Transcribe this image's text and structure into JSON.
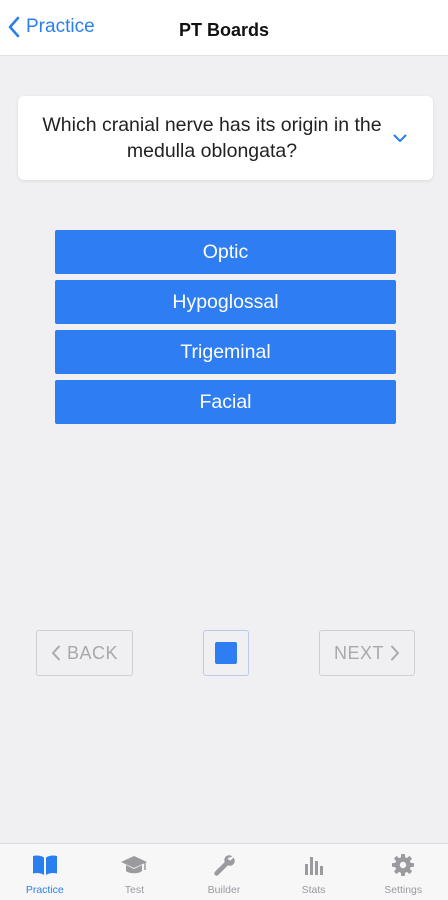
{
  "navbar": {
    "back_label": "Practice",
    "title": "PT Boards"
  },
  "question": {
    "text": "Which cranial nerve has its origin in the medulla oblongata?"
  },
  "answers": [
    {
      "label": "Optic"
    },
    {
      "label": "Hypoglossal"
    },
    {
      "label": "Trigeminal"
    },
    {
      "label": "Facial"
    }
  ],
  "controls": {
    "back_label": "BACK",
    "next_label": "NEXT"
  },
  "tabs": [
    {
      "label": "Practice",
      "icon": "book-icon",
      "active": true
    },
    {
      "label": "Test",
      "icon": "graduation-cap-icon",
      "active": false
    },
    {
      "label": "Builder",
      "icon": "wrench-icon",
      "active": false
    },
    {
      "label": "Stats",
      "icon": "bar-chart-icon",
      "active": false
    },
    {
      "label": "Settings",
      "icon": "gear-icon",
      "active": false
    }
  ],
  "colors": {
    "accent": "#2f7df2",
    "link": "#2a7ff0",
    "inactive": "#9a9a9f",
    "background": "#f0f0f2"
  }
}
